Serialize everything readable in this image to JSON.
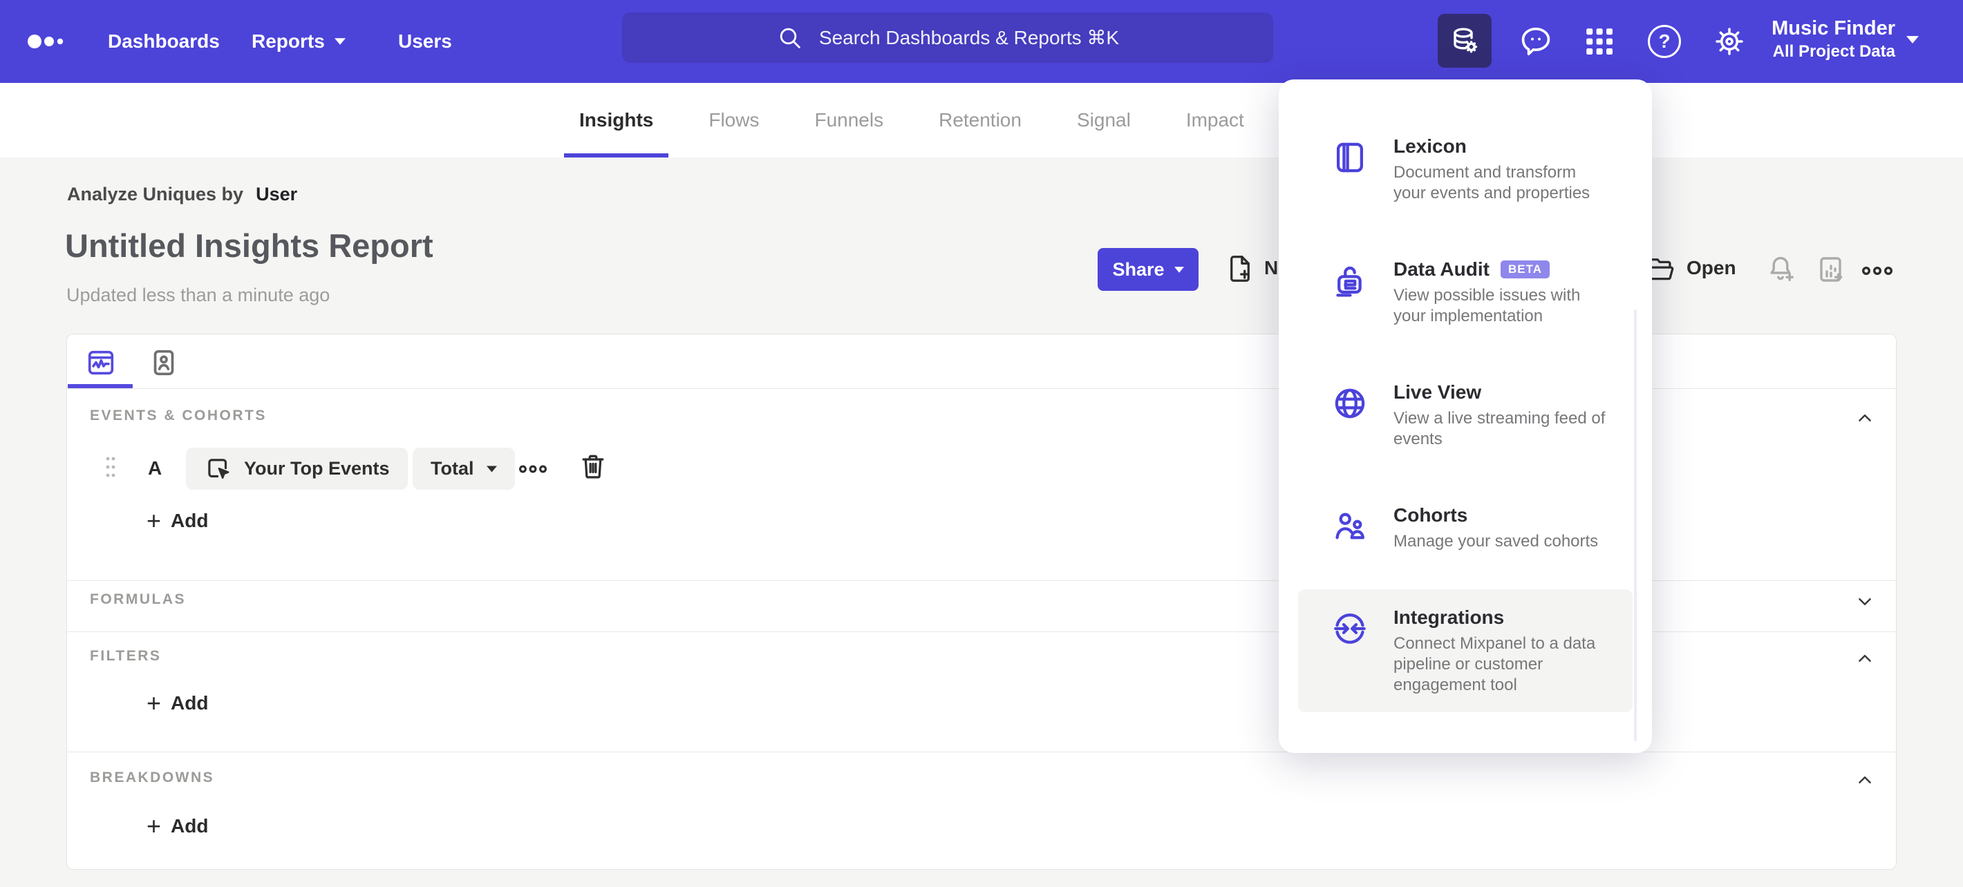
{
  "glyphs": {
    "plus": "+",
    "question": "?"
  },
  "topnav": {
    "links": [
      {
        "label": "Dashboards"
      },
      {
        "label": "Reports"
      },
      {
        "label": "Users"
      }
    ],
    "search_placeholder": "Search Dashboards & Reports ⌘K",
    "project_name": "Music Finder",
    "project_scope": "All Project Data"
  },
  "tabs": [
    {
      "label": "Insights"
    },
    {
      "label": "Flows"
    },
    {
      "label": "Funnels"
    },
    {
      "label": "Retention"
    },
    {
      "label": "Signal"
    },
    {
      "label": "Impact"
    }
  ],
  "report": {
    "analyze_label": "Analyze Uniques by",
    "analyze_value": "User",
    "title": "Untitled Insights Report",
    "updated": "Updated less than a minute ago"
  },
  "toolbar": {
    "share": "Share",
    "new": "New",
    "open": "Open"
  },
  "builder": {
    "events_header": "EVENTS & COHORTS",
    "formulas_header": "FORMULAS",
    "filters_header": "FILTERS",
    "breakdowns_header": "BREAKDOWNS",
    "row": {
      "letter": "A",
      "event": "Your Top Events",
      "metric": "Total"
    },
    "add": "Add"
  },
  "menu": {
    "items": [
      {
        "title": "Lexicon",
        "desc": "Document and transform your events and properties"
      },
      {
        "title": "Data Audit",
        "badge": "BETA",
        "desc": "View possible issues with your implementation"
      },
      {
        "title": "Live View",
        "desc": "View a live streaming feed of events"
      },
      {
        "title": "Cohorts",
        "desc": "Manage your saved cohorts"
      },
      {
        "title": "Integrations",
        "desc": "Connect Mixpanel to a data pipeline or customer engagement tool"
      }
    ]
  },
  "colors": {
    "brand": "#4c43d9",
    "brand_dark": "#322d73",
    "search_bg": "#453cbe",
    "page_bg": "#f5f5f3",
    "beta_badge": "#8f87eb"
  }
}
